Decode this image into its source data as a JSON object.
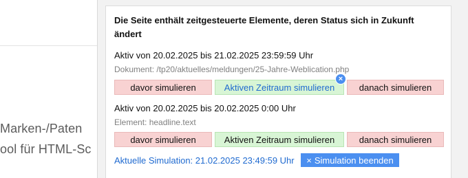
{
  "background": {
    "line1": "Marken-/Paten",
    "line2": "ool für HTML-Sc"
  },
  "panel": {
    "heading": "Die Seite enthält zeitgesteuerte Elemente, deren Status sich in Zukunft ändert",
    "items": [
      {
        "range": "Aktiv von 20.02.2025 bis 21.02.2025 23:59:59 Uhr",
        "meta": "Dokument: /tp20/aktuelles/meldungen/25-Jahre-Weblication.php",
        "before": "davor simulieren",
        "active": "Aktiven Zeitraum simulieren",
        "after": "danach simulieren"
      },
      {
        "range": "Aktiv von 20.02.2025 bis 20.02.2025 0:00 Uhr",
        "meta": "Element: headline.text",
        "before": "davor simulieren",
        "active": "Aktiven Zeitraum simulieren",
        "after": "danach simulieren"
      }
    ],
    "clear_icon": "×",
    "current_simulation": "Aktuelle Simulation: 21.02.2025 23:49:59 Uhr",
    "end_button": "Simulation beenden",
    "end_icon": "×"
  },
  "colors": {
    "accent": "#4b8ff0",
    "link": "#1f6ad0",
    "red_bg": "#f8d2d2",
    "green_bg": "#d8f5d5"
  }
}
